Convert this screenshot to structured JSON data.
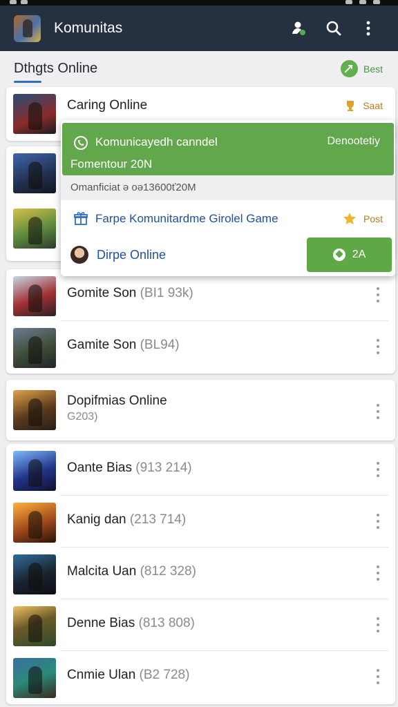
{
  "app": {
    "title": "Komunitas"
  },
  "section": {
    "title": "Dthgts Online",
    "badge_label": "Best"
  },
  "featured": {
    "name": "Caring Online",
    "action_label": "Saat"
  },
  "popup": {
    "header_title": "Komunicayedh canndel",
    "header_right": "Denootetiy",
    "header_sub": "Fomentour 20N",
    "meta": "Omanficiat ə oə13600ť20M",
    "link_label": "Farpe Komunitardme Girolel Game",
    "post_label": "Post",
    "user_label": "Dirpe Online",
    "button_label": "2A"
  },
  "group1": [
    {
      "name": "Gomite Son",
      "count": "(BI1 93k)"
    },
    {
      "name": "Gamite Son",
      "count": "(BL94)"
    }
  ],
  "group2": {
    "name": "Dopifmias Online",
    "count": "G203)"
  },
  "group3": [
    {
      "name": "Oante Bias",
      "count": "(913 214)"
    },
    {
      "name": "Kanig dan",
      "count": "(213 714)"
    },
    {
      "name": "Malcita Uan",
      "count": "(812 328)"
    },
    {
      "name": "Denne Bias",
      "count": "(813 808)"
    },
    {
      "name": "Cnmie Ulan",
      "count": "(B2 728)"
    }
  ],
  "colors": {
    "appbar": "#253041",
    "accent_green": "#63a74c",
    "link_blue": "#1f4f9e",
    "post_orange": "#c0781c"
  },
  "icons": [
    "app-logo",
    "add-person-icon",
    "search-icon",
    "more-vert-icon",
    "refresh-icon",
    "trophy-icon",
    "phone-icon",
    "gift-icon",
    "star-icon",
    "avatar",
    "join-icon"
  ]
}
